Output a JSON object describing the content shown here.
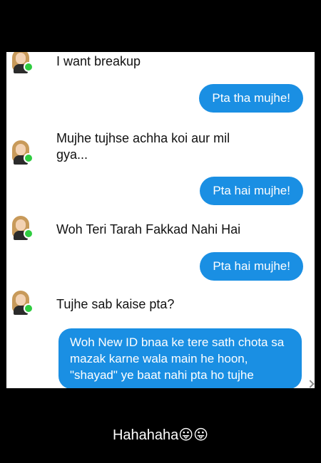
{
  "messages": {
    "m1": "I want breakup",
    "m2": "Pta tha mujhe!",
    "m3": "Mujhe tujhse achha koi aur mil gya...",
    "m4": "Pta hai mujhe!",
    "m5": "Woh Teri Tarah Fakkad Nahi Hai",
    "m6": "Pta hai mujhe!",
    "m7": "Tujhe sab kaise pta?",
    "m8": "Woh New ID bnaa ke tere sath chota sa mazak karne wala main he hoon, \"shayad\" ye baat nahi pta ho tujhe"
  },
  "caption": "Hahahaha😛😛",
  "colors": {
    "sent_bubble": "#1a8fe3",
    "online_dot": "#2ecc40"
  }
}
